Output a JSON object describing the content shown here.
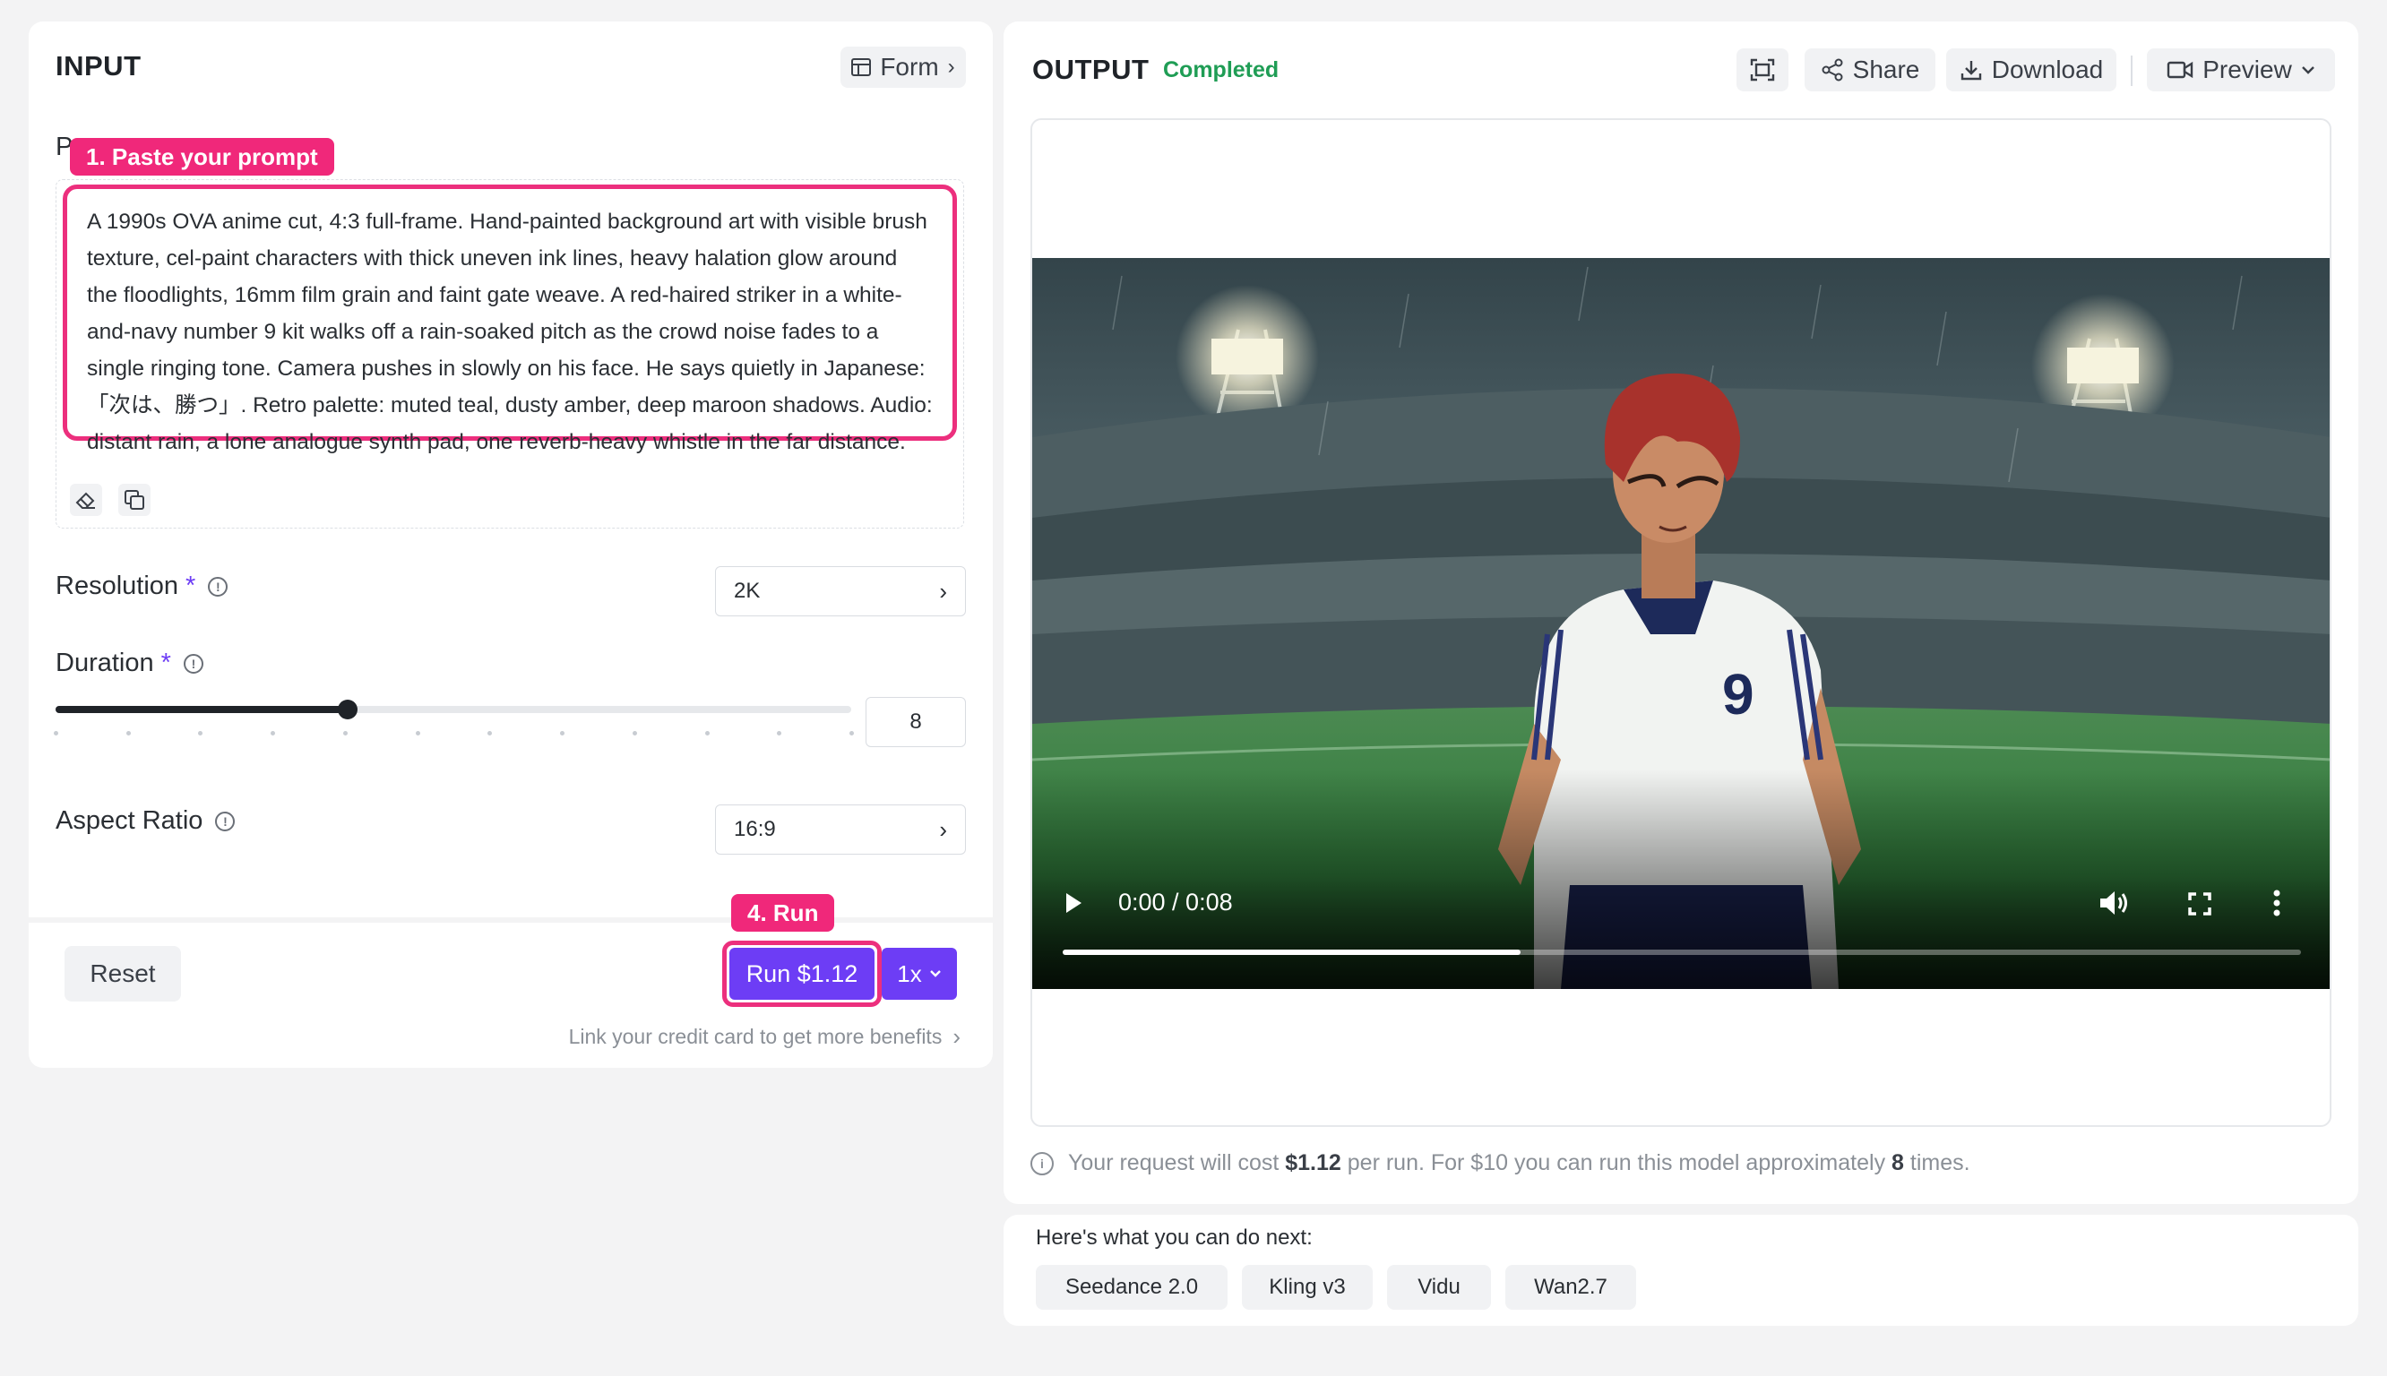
{
  "input": {
    "title": "INPUT",
    "form_label": "Form",
    "prompt_label": "Prompt",
    "annotation_prompt": "1. Paste your prompt",
    "prompt_text": "A 1990s OVA anime cut, 4:3 full-frame. Hand-painted background art with visible brush texture, cel-paint characters with thick uneven ink lines, heavy halation glow around the floodlights, 16mm film grain and faint gate weave. A red-haired striker in a white-and-navy number 9 kit walks off a rain-soaked pitch as the crowd noise fades to a single ringing tone. Camera pushes in slowly on his face. He says quietly in Japanese: 「次は、勝つ」. Retro palette: muted teal, dusty amber, deep maroon shadows. Audio: distant rain, a lone analogue synth pad, one reverb-heavy whistle in the far distance.",
    "resolution": {
      "label": "Resolution",
      "required": "*",
      "value": "2K"
    },
    "duration": {
      "label": "Duration",
      "required": "*",
      "value": "8",
      "slider_fraction": 0.367
    },
    "aspect_ratio": {
      "label": "Aspect Ratio",
      "value": "16:9"
    },
    "reset_label": "Reset",
    "annotation_run": "4. Run",
    "run_label": "Run $1.12",
    "multiplier": "1x",
    "credit_link": "Link your credit card to get more benefits"
  },
  "output": {
    "title": "OUTPUT",
    "status": "Completed",
    "share_label": "Share",
    "download_label": "Download",
    "preview_label": "Preview",
    "video_time": "0:00 / 0:08",
    "video_progress": 0.37,
    "jersey_number": "9",
    "cost_prefix": "Your request will cost ",
    "cost_value": "$1.12",
    "cost_mid": " per run. For $10 you can run this model approximately ",
    "cost_times": "8",
    "cost_suffix": " times."
  },
  "next": {
    "heading": "Here's what you can do next:",
    "chips": [
      "Seedance 2.0",
      "Kling v3",
      "Vidu",
      "Wan2.7"
    ]
  },
  "colors": {
    "accent": "#6d3df5",
    "annotation": "#f0287a",
    "status_green": "#1f9d55"
  }
}
